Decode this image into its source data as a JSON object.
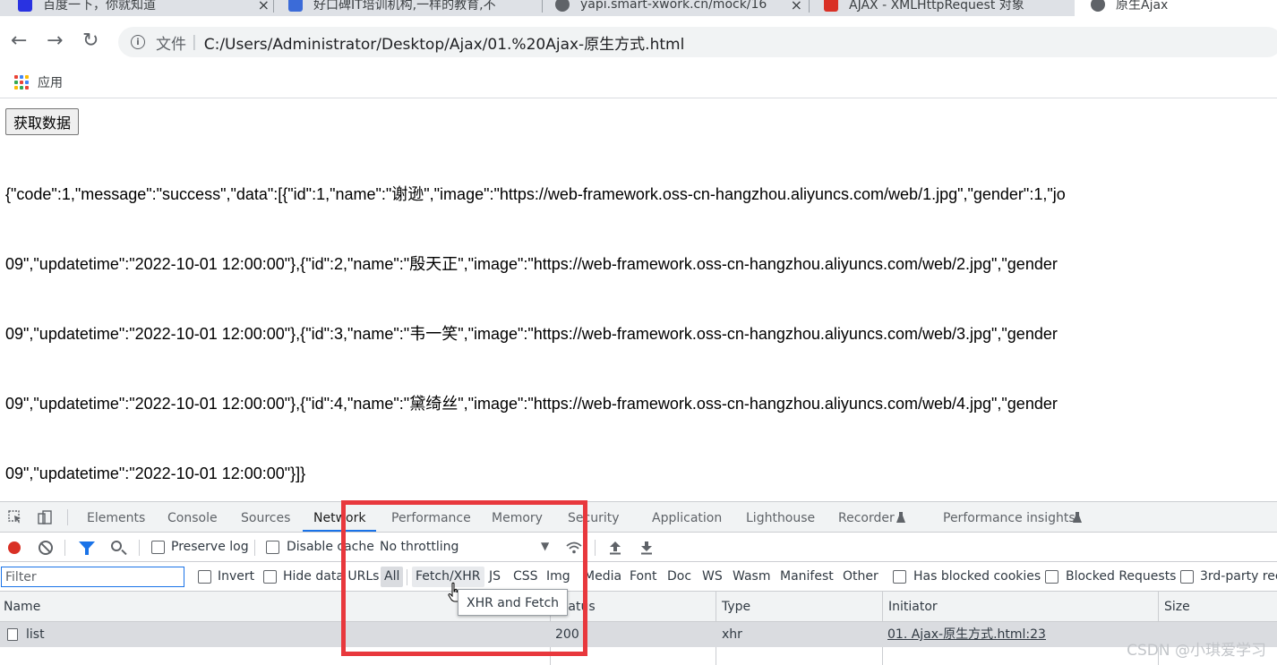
{
  "browser": {
    "tabs": [
      {
        "title": "百度一下，你就知道",
        "icon_color": "#2932e1"
      },
      {
        "title": "好口碑IT培训机构,一样的教育,不",
        "icon_color": "#3b6bd8"
      },
      {
        "title": "yapi.smart-xwork.cn/mock/16",
        "icon_color": "#5f6368"
      },
      {
        "title": "AJAX - XMLHttpRequest 对象",
        "icon_color": "#d93025"
      },
      {
        "title": "原生Ajax",
        "icon_color": "#5f6368"
      }
    ],
    "close_glyph": "×",
    "nav": {
      "back_icon": "arrow-left-icon",
      "forward_icon": "arrow-right-icon",
      "reload_icon": "reload-icon"
    },
    "omnibox": {
      "label": "文件",
      "separator": "|",
      "url": "C:/Users/Administrator/Desktop/Ajax/01.%20Ajax-原生方式.html"
    },
    "bookmarks": {
      "apps_label": "应用"
    }
  },
  "page": {
    "button_label": "获取数据",
    "json_lines": [
      "{\"code\":1,\"message\":\"success\",\"data\":[{\"id\":1,\"name\":\"谢逊\",\"image\":\"https://web-framework.oss-cn-hangzhou.aliyuncs.com/web/1.jpg\",\"gender\":1,\"jo",
      "09\",\"updatetime\":\"2022-10-01 12:00:00\"},{\"id\":2,\"name\":\"殷天正\",\"image\":\"https://web-framework.oss-cn-hangzhou.aliyuncs.com/web/2.jpg\",\"gender",
      "09\",\"updatetime\":\"2022-10-01 12:00:00\"},{\"id\":3,\"name\":\"韦一笑\",\"image\":\"https://web-framework.oss-cn-hangzhou.aliyuncs.com/web/3.jpg\",\"gender",
      "09\",\"updatetime\":\"2022-10-01 12:00:00\"},{\"id\":4,\"name\":\"黛绮丝\",\"image\":\"https://web-framework.oss-cn-hangzhou.aliyuncs.com/web/4.jpg\",\"gender",
      "09\",\"updatetime\":\"2022-10-01 12:00:00\"}]}"
    ]
  },
  "devtools": {
    "panels": [
      "Elements",
      "Console",
      "Sources",
      "Network",
      "Performance",
      "Memory",
      "Security",
      "Application",
      "Lighthouse",
      "Recorder",
      "Performance insights"
    ],
    "active_panel": "Network",
    "toolbar": {
      "preserve_log": "Preserve log",
      "disable_cache": "Disable cache",
      "throttling": "No throttling",
      "dropdown_glyph": "▼"
    },
    "filter": {
      "placeholder": "Filter",
      "invert": "Invert",
      "hide_data_urls": "Hide data URLs",
      "types": [
        "All",
        "Fetch/XHR",
        "JS",
        "CSS",
        "Img",
        "Media",
        "Font",
        "Doc",
        "WS",
        "Wasm",
        "Manifest",
        "Other"
      ],
      "has_blocked_cookies": "Has blocked cookies",
      "blocked_requests": "Blocked Requests",
      "third_party": "3rd-party rec"
    },
    "table": {
      "headers": {
        "name": "Name",
        "status": "Status",
        "type": "Type",
        "initiator": "Initiator",
        "size": "Size"
      },
      "rows": [
        {
          "name": "list",
          "status": "200",
          "type": "xhr",
          "initiator": "01. Ajax-原生方式.html:23"
        }
      ]
    },
    "tooltip": "XHR and Fetch"
  },
  "annotation": {
    "highlight_color": "#e8383d"
  },
  "watermark": "CSDN @小琪爱学习"
}
